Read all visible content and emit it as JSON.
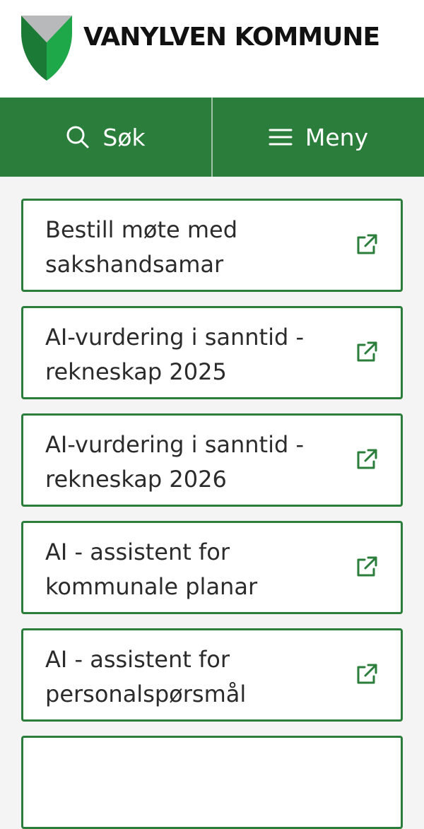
{
  "header": {
    "brand": "VANYLVEN KOMMUNE",
    "logo_icon": "shield-v-logo",
    "colors": {
      "logo_green": "#1fa84a",
      "logo_dark_green": "#1b7a35",
      "logo_grey": "#b7b9bb"
    }
  },
  "nav": {
    "search_label": "Søk",
    "search_icon": "search-icon",
    "menu_label": "Meny",
    "menu_icon": "hamburger-icon",
    "background": "#2a7d3a"
  },
  "links": [
    {
      "label": "Bestill møte med sakshandsamar",
      "icon": "external-link-icon"
    },
    {
      "label": "AI-vurdering i sanntid - rekneskap 2025",
      "icon": "external-link-icon"
    },
    {
      "label": "AI-vurdering i sanntid - rekneskap 2026",
      "icon": "external-link-icon"
    },
    {
      "label": "AI - assistent for kommunale planar",
      "icon": "external-link-icon"
    },
    {
      "label": "AI - assistent for personalspørsmål",
      "icon": "external-link-icon"
    }
  ],
  "accent_color": "#2a7d3a"
}
